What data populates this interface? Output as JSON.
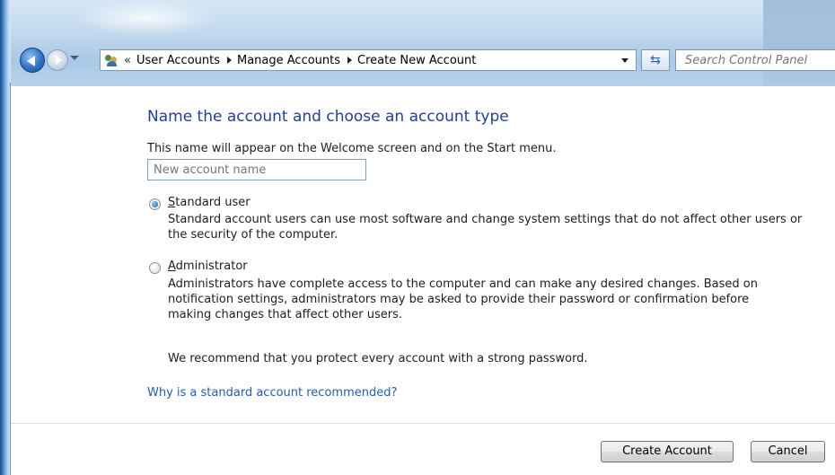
{
  "address_bar": {
    "overflow_chevron": "«",
    "breadcrumbs": [
      "User Accounts",
      "Manage Accounts",
      "Create New Account"
    ]
  },
  "search": {
    "placeholder": "Search Control Panel"
  },
  "content": {
    "heading": "Name the account and choose an account type",
    "subtext": "This name will appear on the Welcome screen and on the Start menu.",
    "name_input": {
      "value": "",
      "placeholder": "New account name"
    },
    "options": [
      {
        "label_accel": "S",
        "label_rest": "tandard user",
        "checked": true,
        "description_lines": [
          "Standard account users can use most software and change system settings that do not affect other users or",
          "the security of the computer."
        ]
      },
      {
        "label_accel": "A",
        "label_rest": "dministrator",
        "checked": false,
        "description_lines": [
          "Administrators have complete access to the computer and can make any desired changes. Based on",
          "notification settings, administrators may be asked to provide their password or confirmation before",
          "making changes that affect other users."
        ]
      }
    ],
    "recommendation": "We recommend that you protect every account with a strong password.",
    "help_link": "Why is a standard account recommended?"
  },
  "buttons": {
    "create": "Create Account",
    "cancel": "Cancel"
  },
  "colors": {
    "heading": "#1e3f9c",
    "link": "#1e5fb5",
    "frame": "#3a7bc0"
  }
}
